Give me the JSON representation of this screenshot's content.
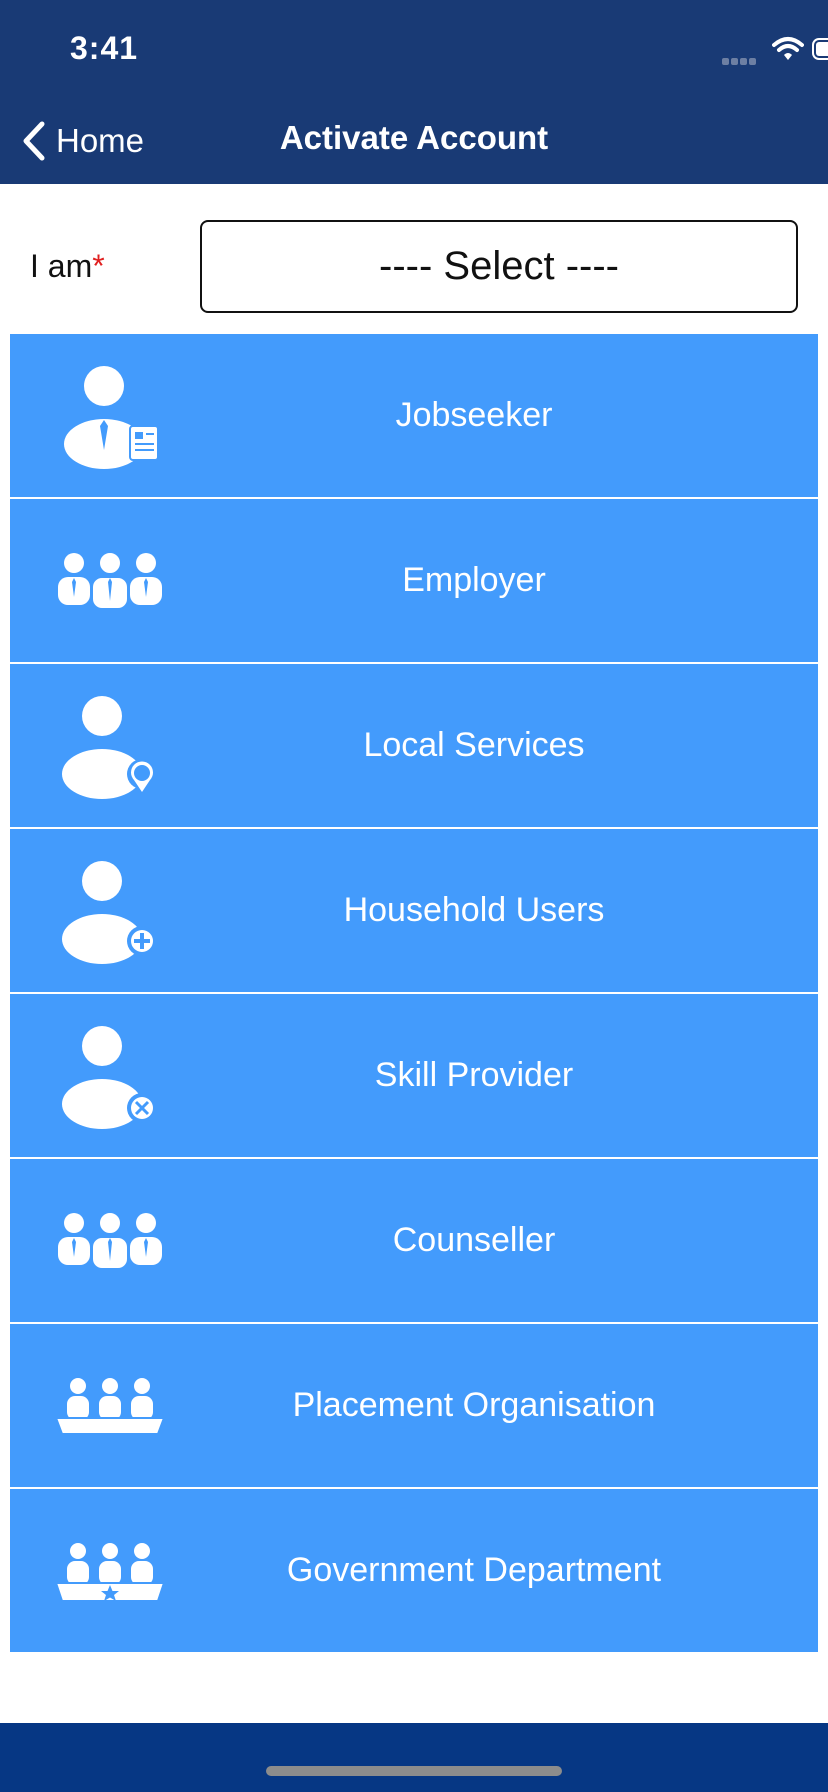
{
  "status_bar": {
    "time": "3:41"
  },
  "nav": {
    "back_label": "Home",
    "title": "Activate Account"
  },
  "form": {
    "label": "I am",
    "required_mark": "*",
    "select_value": "---- Select ----"
  },
  "options": [
    {
      "label": "Jobseeker",
      "icon": "jobseeker-icon"
    },
    {
      "label": "Employer",
      "icon": "employer-group-icon"
    },
    {
      "label": "Local Services",
      "icon": "local-services-icon"
    },
    {
      "label": "Household Users",
      "icon": "household-user-icon"
    },
    {
      "label": "Skill Provider",
      "icon": "skill-provider-icon"
    },
    {
      "label": "Counseller",
      "icon": "counseller-group-icon"
    },
    {
      "label": "Placement Organisation",
      "icon": "placement-organisation-icon"
    },
    {
      "label": "Government Department",
      "icon": "government-department-icon"
    }
  ],
  "colors": {
    "nav_bg": "#193a75",
    "option_bg": "#439bfc",
    "bottom_bar": "#063784",
    "required": "#e02020"
  }
}
